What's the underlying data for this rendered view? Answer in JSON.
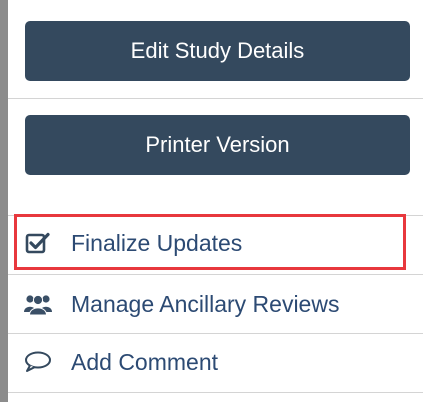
{
  "buttons": {
    "edit_study_details": "Edit Study Details",
    "printer_version": "Printer Version"
  },
  "menu": {
    "items": [
      {
        "label": "Finalize Updates",
        "icon": "checkbox-checked-icon",
        "highlighted": true
      },
      {
        "label": "Manage Ancillary Reviews",
        "icon": "users-icon",
        "highlighted": false
      },
      {
        "label": "Add Comment",
        "icon": "comment-icon",
        "highlighted": false
      }
    ]
  },
  "colors": {
    "button_bg": "#34495e",
    "button_text": "#ffffff",
    "link_text": "#2c4a73",
    "highlight": "#e8383d",
    "divider": "#d4d4d4"
  }
}
